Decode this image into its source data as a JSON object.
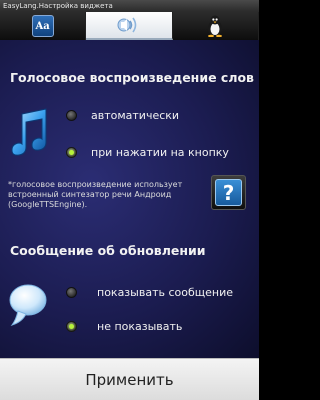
{
  "window": {
    "title": "EasyLang.Настройка виджета"
  },
  "tabs": [
    {
      "icon": "dictionary-icon",
      "label": "Aa"
    },
    {
      "icon": "sound-icon",
      "active": true
    },
    {
      "icon": "linux-penguin-icon"
    }
  ],
  "voice_section": {
    "heading": "Голосовое воспроизведение слов",
    "options": [
      {
        "label": "автоматически",
        "selected": false
      },
      {
        "label": "при нажатии на кнопку",
        "selected": true
      }
    ],
    "note": "*голосовое воспроизведение использует встроенный синтезатор речи Андроид (GoogleTTSEngine).",
    "help_label": "?"
  },
  "update_section": {
    "heading": "Сообщение об обновлении",
    "options": [
      {
        "label": "показывать сообщение",
        "selected": false
      },
      {
        "label": "не показывать",
        "selected": true
      }
    ]
  },
  "footer": {
    "apply_label": "Применить"
  },
  "colors": {
    "panel": "#1b1c50",
    "radio_checked": "#b6f23a",
    "footer_bg": "#ececec"
  }
}
